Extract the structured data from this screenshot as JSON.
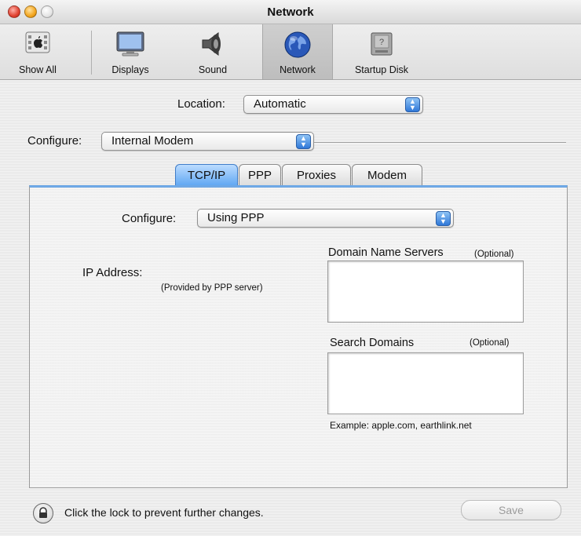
{
  "window": {
    "title": "Network"
  },
  "toolbar": {
    "items": [
      {
        "label": "Show All",
        "icon": "apple-grid-icon"
      },
      {
        "label": "Displays",
        "icon": "display-icon"
      },
      {
        "label": "Sound",
        "icon": "speaker-icon"
      },
      {
        "label": "Network",
        "icon": "globe-icon",
        "selected": true
      },
      {
        "label": "Startup Disk",
        "icon": "disk-icon"
      }
    ]
  },
  "location": {
    "label": "Location:",
    "value": "Automatic"
  },
  "configure_top": {
    "label": "Configure:",
    "value": "Internal Modem"
  },
  "tabs": [
    {
      "label": "TCP/IP",
      "selected": true
    },
    {
      "label": "PPP"
    },
    {
      "label": "Proxies"
    },
    {
      "label": "Modem"
    }
  ],
  "panel": {
    "configure": {
      "label": "Configure:",
      "value": "Using PPP"
    },
    "ip_address": {
      "label": "IP Address:",
      "note": "(Provided by PPP server)"
    },
    "dns": {
      "label": "Domain Name Servers",
      "optional": "(Optional)"
    },
    "search_domains": {
      "label": "Search Domains",
      "optional": "(Optional)"
    },
    "example": "Example: apple.com, earthlink.net"
  },
  "footer": {
    "lock_text": "Click the lock to prevent further changes.",
    "save_label": "Save"
  },
  "colors": {
    "accent": "#5ea6f2",
    "selected_tab_border": "#3f7cc7"
  }
}
